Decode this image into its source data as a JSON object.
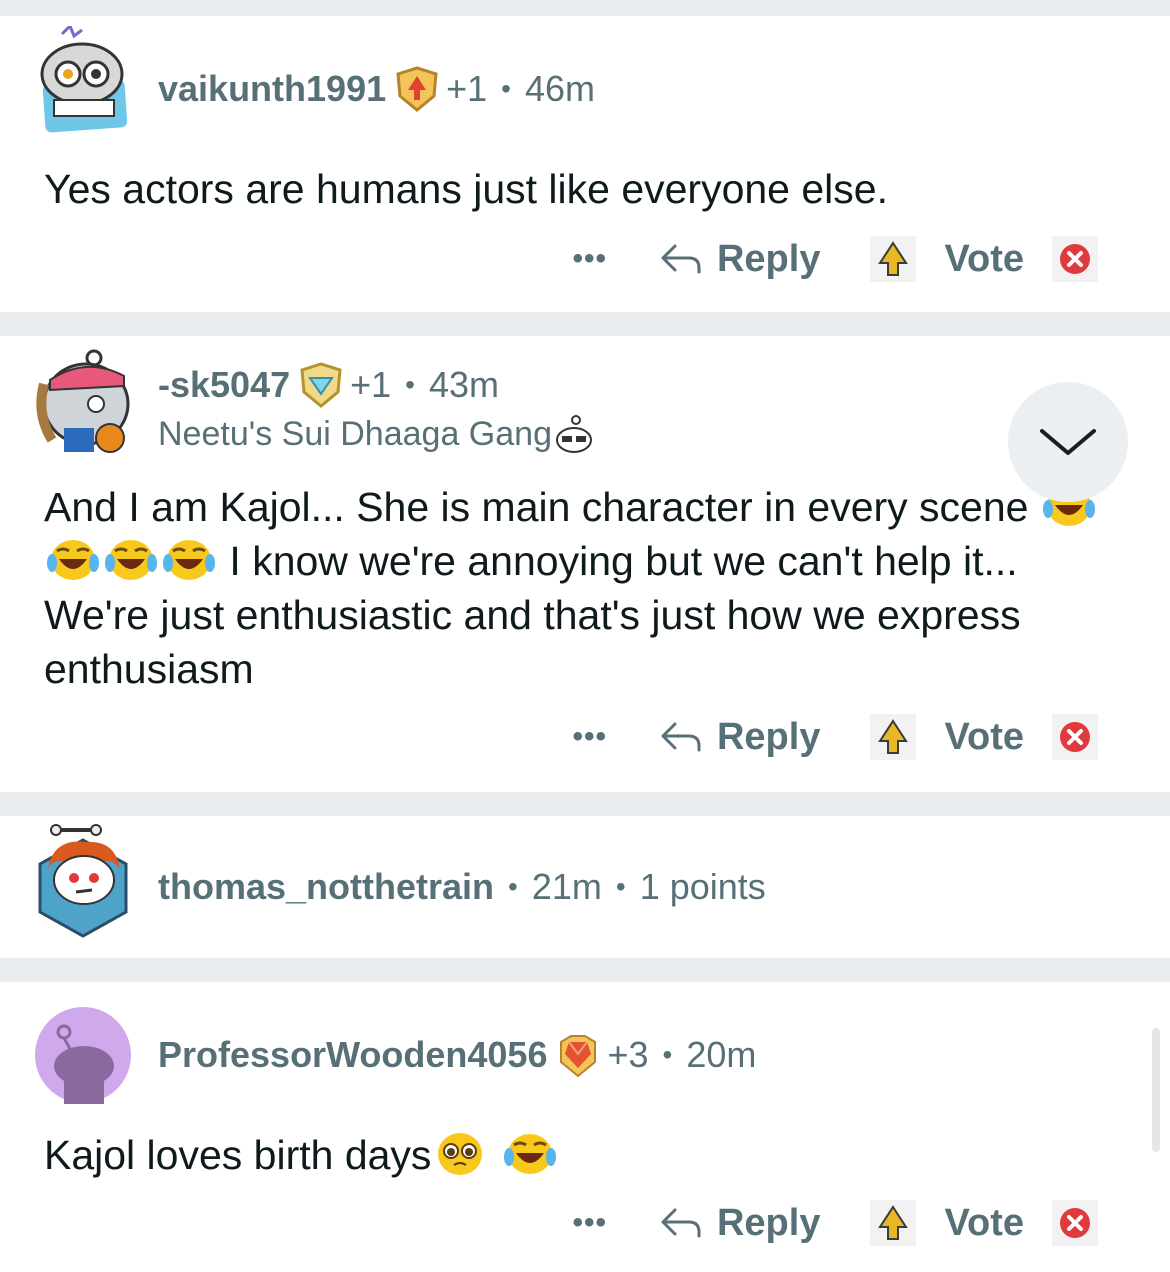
{
  "comments": [
    {
      "username": "vaikunth1991",
      "karma": "+1",
      "time": "46m",
      "text": "Yes actors are humans just like everyone else.",
      "avatar_icon": "controller-avatar-icon",
      "badge_icon": "gold-shield-badge-icon"
    },
    {
      "username": "-sk5047",
      "karma": "+1",
      "time": "43m",
      "flair": "Neetu's Sui Dhaaga Gang",
      "text_part1": "And I am Kajol... She is main character in every scene",
      "text_part2": "I know we're annoying but we can't help it... We're just enthusiastic and that's just how we express enthusiasm",
      "avatar_icon": "basketball-avatar-icon",
      "badge_icon": "diamond-shield-badge-icon"
    },
    {
      "username": "thomas_notthetrain",
      "time": "21m",
      "points": "1 points",
      "avatar_icon": "redhair-avatar-icon"
    },
    {
      "username": "ProfessorWooden4056",
      "karma": "+3",
      "time": "20m",
      "text": "Kajol loves birth days",
      "avatar_icon": "default-purple-avatar-icon",
      "badge_icon": "crystal-badge-icon"
    }
  ],
  "actions": {
    "more": "•••",
    "reply": "Reply",
    "vote": "Vote"
  },
  "colors": {
    "separator": "#eaedef",
    "meta_text": "#576f76",
    "body_text": "#0f1a1c",
    "downvote": "#e0393e",
    "upvote": "#e8b824"
  }
}
